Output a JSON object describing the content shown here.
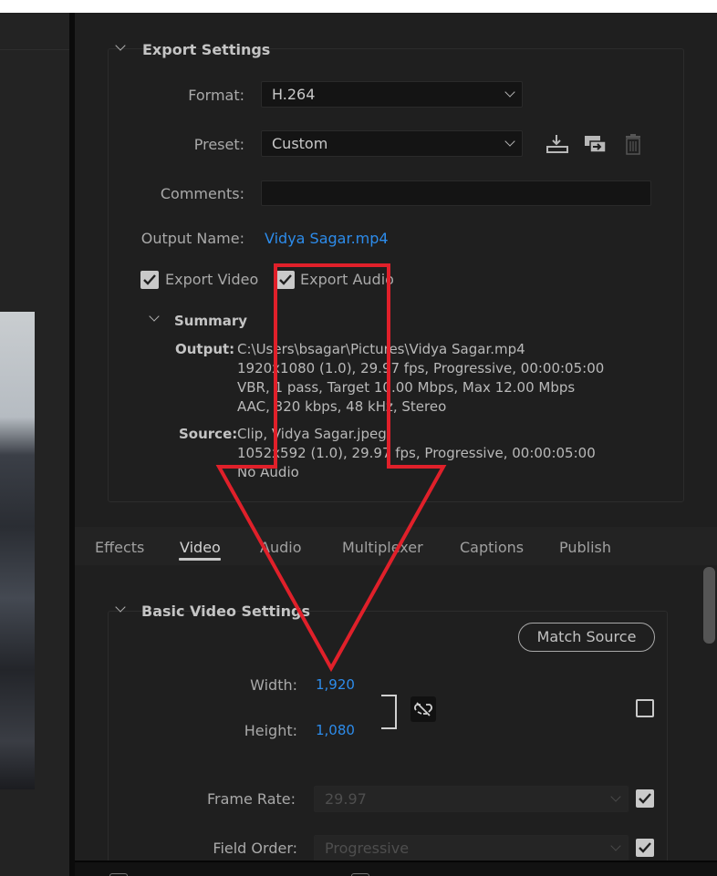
{
  "export_settings": {
    "title": "Export Settings",
    "format_label": "Format:",
    "format_value": "H.264",
    "preset_label": "Preset:",
    "preset_value": "Custom",
    "comments_label": "Comments:",
    "comments_value": "",
    "output_name_label": "Output Name:",
    "output_name_value": "Vidya Sagar.mp4",
    "export_video_label": "Export Video",
    "export_video_checked": true,
    "export_audio_label": "Export Audio",
    "export_audio_checked": true
  },
  "summary": {
    "title": "Summary",
    "output_label": "Output:",
    "output_lines": [
      "C:\\Users\\bsagar\\Pictures\\Vidya Sagar.mp4",
      "1920x1080 (1.0), 29.97 fps, Progressive, 00:00:05:00",
      "VBR, 1 pass, Target 10.00 Mbps, Max 12.00 Mbps",
      "AAC, 320 kbps, 48 kHz, Stereo"
    ],
    "source_label": "Source:",
    "source_lines": [
      "Clip, Vidya Sagar.jpeg",
      "1052x592 (1.0), 29.97 fps, Progressive, 00:00:05:00",
      "No Audio"
    ]
  },
  "tabs": [
    "Effects",
    "Video",
    "Audio",
    "Multiplexer",
    "Captions",
    "Publish"
  ],
  "active_tab": "Video",
  "basic_video": {
    "title": "Basic Video Settings",
    "match_source_label": "Match Source",
    "width_label": "Width:",
    "width_value": "1,920",
    "height_label": "Height:",
    "height_value": "1,080",
    "frame_rate_label": "Frame Rate:",
    "frame_rate_value": "29.97",
    "field_order_label": "Field Order:",
    "field_order_value": "Progressive"
  },
  "icons": {
    "save_preset": "save-preset-icon",
    "import_preset": "import-preset-icon",
    "delete_preset": "trash-icon",
    "link_dimensions": "unlink-icon"
  },
  "colors": {
    "accent_link": "#2d8ceb",
    "annotation_arrow": "#e0202a",
    "panel_bg": "#1f1f1f"
  }
}
